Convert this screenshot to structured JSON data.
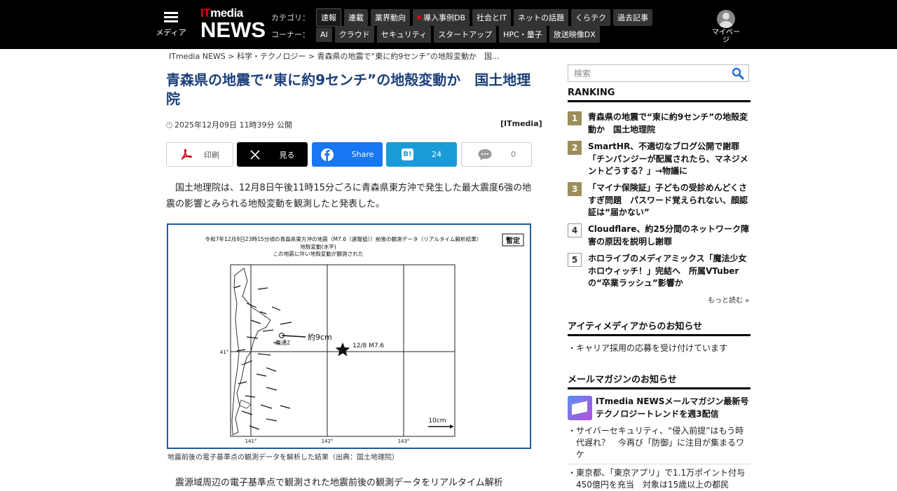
{
  "header": {
    "menu_label": "メディア",
    "logo_it": "IT",
    "logo_media": "media",
    "logo_news": "NEWS",
    "category_label": "カテゴリ：",
    "categories": [
      "速報",
      "連載",
      "業界動向",
      "導入事例DB",
      "社会とIT",
      "ネットの話題",
      "くらテク",
      "過去記事"
    ],
    "corner_label": "コーナー：",
    "corners": [
      "AI",
      "クラウド",
      "セキュリティ",
      "スタートアップ",
      "HPC・量子",
      "放送映像DX"
    ],
    "mypage_label": "マイページ"
  },
  "breadcrumb": {
    "home": "ITmedia NEWS",
    "sep": ">",
    "section": "科学・テクノロジー",
    "current": "青森県の地震で“東に約9センチ”の地殻変動か　国..."
  },
  "article": {
    "title": "青森県の地震で“東に約9センチ”の地殻変動か　国土地理院",
    "date": "2025年12月09日 11時39分 公開",
    "source": "[ITmedia]",
    "lead": "国土地理院は、12月8日午後11時15分ごろに青森県東方沖で発生した最大震度6強の地震の影響とみられる地殻変動を観測したと発表した。",
    "caption": "地震前後の電子基準点の観測データを解析した結果（出典：国土地理院）",
    "body2": "震源域周辺の電子基準点で観測された地震前後の観測データをリアルタイム解析"
  },
  "share": {
    "print": "印刷",
    "x": "見る",
    "facebook": "Share",
    "hatena_icon": "B!",
    "hatena_count": "24",
    "comment_count": "0"
  },
  "figure": {
    "title_line1": "令和7年12月8日23時15分頃の青森県東方沖の地震（M7.6（速報値））前後の観測データ（リアルタイム解析結果）",
    "title_line2": "地殻変動(水平)",
    "title_line3": "この地震に伴い地殻変動が観測された",
    "badge": "暫定",
    "station": "東通2",
    "vector_label": "約9cm",
    "quake_label": "12/8 M7.6",
    "scale_label": "10cm",
    "lon_labels": [
      "141°",
      "142°",
      "143°"
    ],
    "lat_label": "41°"
  },
  "sidebar": {
    "search_placeholder": "検索",
    "ranking_title": "RANKING",
    "ranking": [
      {
        "num": "1",
        "title": "青森県の地震で“東に約9センチ”の地殻変動か　国土地理院"
      },
      {
        "num": "2",
        "title": "SmartHR、不適切なブログ公開で謝罪「チンパンジーが配属されたら、マネジメントどうする？」→物議に"
      },
      {
        "num": "3",
        "title": "「マイナ保険証」子どもの受診めんどくさすぎ問題　パスワード覚えられない、顔認証は“届かない”"
      },
      {
        "num": "4",
        "title": "Cloudflare、約25分間のネットワーク障害の原因を説明し謝罪"
      },
      {
        "num": "5",
        "title": "ホロライブのメディアミックス「魔法少女ホロウィッチ！」完結へ　所属VTuberの“卒業ラッシュ”影響か"
      }
    ],
    "more": "もっと読む »",
    "notice_title": "アイティメディアからのお知らせ",
    "notice_item": "キャリア採用の応募を受け付けています",
    "mail_title": "メールマガジンのお知らせ",
    "mail_feature": "ITmedia NEWSメールマガジン最新号 テクノロジートレンドを週3配信",
    "mail_items": [
      "サイバーセキュリティ、“侵入前提”はもう時代遅れ？　今再び「防御」に注目が集まるワケ",
      "東京都、「東京アプリ」で1.1万ポイント付与　450億円を充当　対象は15歳以上の都民"
    ]
  },
  "colors": {
    "headline": "#1b3f7a",
    "accent_red": "#e60012",
    "rank_gold": "#9c8d5a",
    "figure_border": "#1f5aa0"
  }
}
